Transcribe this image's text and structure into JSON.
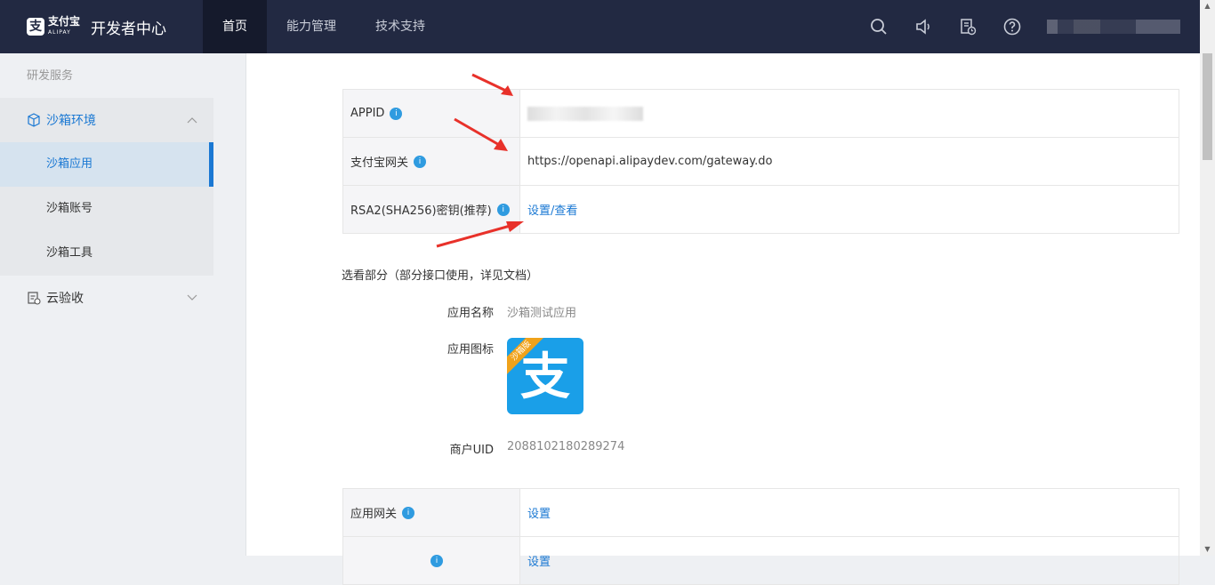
{
  "header": {
    "logo_mark": "支",
    "logo_text": "支付宝",
    "logo_sub": "ALIPAY",
    "title": "开发者中心",
    "nav": [
      "首页",
      "能力管理",
      "技术支持"
    ],
    "user_suffix": "]"
  },
  "sidebar": {
    "section": "研发服务",
    "group": "沙箱环境",
    "sub_items": [
      "沙箱应用",
      "沙箱账号",
      "沙箱工具"
    ],
    "group2": "云验收"
  },
  "basic": {
    "appid_label": "APPID",
    "gateway_label": "支付宝网关",
    "gateway_value": "https://openapi.alipaydev.com/gateway.do",
    "rsa_label": "RSA2(SHA256)密钥(推荐)",
    "rsa_action": "设置/查看",
    "info_glyph": "i"
  },
  "optional": {
    "title": "选看部分（部分接口使用，详见文档）",
    "app_name_label": "应用名称",
    "app_name_value": "沙箱测试应用",
    "app_icon_label": "应用图标",
    "app_icon_tag": "沙箱版",
    "app_icon_glyph": "支",
    "uid_label": "商户UID",
    "uid_value": "2088102180289274"
  },
  "extra": {
    "gateway_label": "应用网关",
    "gateway_action": "设置",
    "row2_action": "设置"
  },
  "colors": {
    "topbar": "#222942",
    "accent": "#1a78d3",
    "arrow": "#e8312a"
  }
}
